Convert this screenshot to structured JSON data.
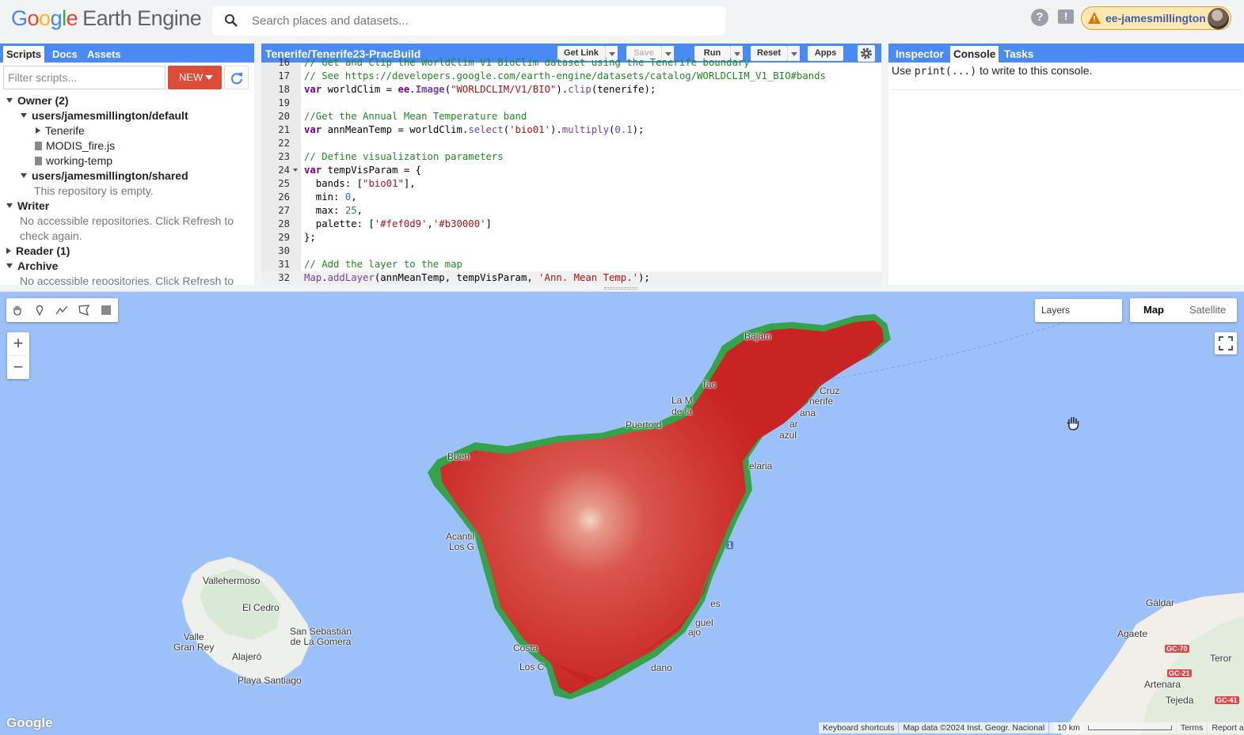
{
  "header": {
    "logo_google": [
      "G",
      "o",
      "o",
      "g",
      "l",
      "e"
    ],
    "logo_product": "Earth Engine",
    "search_placeholder": "Search places and datasets...",
    "help_label": "?",
    "feedback_label": "!",
    "account_name": "ee-jamesmillington"
  },
  "left_panel": {
    "tabs": [
      "Scripts",
      "Docs",
      "Assets"
    ],
    "active_tab": "Scripts",
    "filter_placeholder": "Filter scripts...",
    "new_label": "NEW",
    "tree": [
      {
        "label": "Owner (2)"
      },
      {
        "label": "users/jamesmillington/default"
      },
      {
        "label": "Tenerife"
      },
      {
        "label": "MODIS_fire.js"
      },
      {
        "label": "working-temp"
      },
      {
        "label": "users/jamesmillington/shared"
      },
      {
        "label": "This repository is empty."
      },
      {
        "label": "Writer"
      },
      {
        "label": "No accessible repositories. Click Refresh to"
      },
      {
        "label": "check again."
      },
      {
        "label": "Reader (1)"
      },
      {
        "label": "Archive"
      },
      {
        "label": "No accessible repositories. Click Refresh to"
      }
    ]
  },
  "editor": {
    "title": "Tenerife/Tenerife23-PracBuild",
    "buttons": {
      "get_link": "Get Link",
      "save": "Save",
      "run": "Run",
      "reset": "Reset",
      "apps": "Apps"
    },
    "lines": [
      {
        "num": "16",
        "text": "// Get and Clip the WorldClim V1 BioClim dataset using the Tenerife boundary"
      },
      {
        "num": "17",
        "text": "// See https://developers.google.com/earth-engine/datasets/catalog/WORLDCLIM_V1_BIO#bands"
      },
      {
        "num": "18",
        "text": "var worldClim = ee.Image(\"WORLDCLIM/V1/BIO\").clip(tenerife);"
      },
      {
        "num": "19",
        "text": ""
      },
      {
        "num": "20",
        "text": "//Get the Annual Mean Temperature band"
      },
      {
        "num": "21",
        "text": "var annMeanTemp = worldClim.select('bio01').multiply(0.1);"
      },
      {
        "num": "22",
        "text": ""
      },
      {
        "num": "23",
        "text": "// Define visualization parameters"
      },
      {
        "num": "24",
        "text": "var tempVisParam = {"
      },
      {
        "num": "25",
        "text": "  bands: [\"bio01\"],"
      },
      {
        "num": "26",
        "text": "  min: 0,"
      },
      {
        "num": "27",
        "text": "  max: 25,"
      },
      {
        "num": "28",
        "text": "  palette: ['#fef0d9','#b30000']"
      },
      {
        "num": "29",
        "text": "};"
      },
      {
        "num": "30",
        "text": ""
      },
      {
        "num": "31",
        "text": "// Add the layer to the map"
      },
      {
        "num": "32",
        "text": "Map.addLayer(annMeanTemp, tempVisParam, 'Ann. Mean Temp.');"
      }
    ]
  },
  "right_panel": {
    "tabs": [
      "Inspector",
      "Console",
      "Tasks"
    ],
    "active_tab": "Console",
    "console_prefix": "Use ",
    "console_code": "print(...)",
    "console_suffix": " to write to this console."
  },
  "map": {
    "layers_label": "Layers",
    "map_type_options": [
      "Map",
      "Satellite"
    ],
    "selected_map_type": "Map",
    "zoom_in": "+",
    "zoom_out": "−",
    "labels": {
      "vallehermoso": "Vallehermoso",
      "el_cedro": "El Cedro",
      "valle_gran_rey": "Valle\nGran Rey",
      "san_sebastian": "San Sebastián\nde La Gomera",
      "alajero": "Alajeró",
      "playa_santiago": "Playa Santiago",
      "baja": "Bajam",
      "tac": "Tac",
      "la_m": "La M",
      "de_la": "de la",
      "cruz": "Cruz",
      "tenerife": "nerife",
      "ana": "ana",
      "puerto": "Puerto d",
      "ar": "ar",
      "azul": "azul",
      "buen": "Buen",
      "elaria": "elaria",
      "acantil": "Acantil",
      "los_g": "Los G",
      "es": "es",
      "guel": "guel",
      "ajo": "ajo",
      "costa": "Costa",
      "los_c": "Los C",
      "dano": "dano",
      "galdar": "Gáldar",
      "agaete": "Agaete",
      "teror": "Teror",
      "artenara": "Artenara",
      "tejeda": "Tejeda"
    },
    "road_badges": {
      "gc70": "GC-70",
      "gc21": "GC-21",
      "gc41": "GC-41",
      "tf1": "1"
    },
    "google_logo": "Google",
    "attribution": {
      "shortcuts": "Keyboard shortcuts",
      "data": "Map data ©2024 Inst. Geogr. Nacional",
      "scale": "10 km",
      "terms": "Terms",
      "report": "Report a map error"
    },
    "layer_palette": [
      "#fef0d9",
      "#b30000"
    ]
  }
}
